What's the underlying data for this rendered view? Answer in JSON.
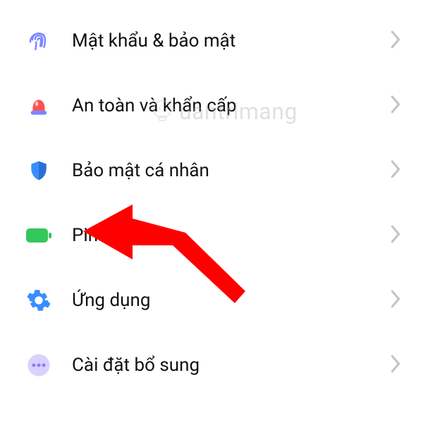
{
  "items": [
    {
      "id": "password-security",
      "label": "Mật khẩu & bảo mật"
    },
    {
      "id": "safety-emergency",
      "label": "An toàn và khẩn cấp"
    },
    {
      "id": "privacy",
      "label": "Bảo mật cá nhân"
    },
    {
      "id": "battery",
      "label": "Pin"
    },
    {
      "id": "apps",
      "label": "Ứng dụng"
    },
    {
      "id": "additional",
      "label": "Cài đặt bổ sung"
    }
  ],
  "watermark": {
    "text": "uantrimang"
  },
  "colors": {
    "fingerprint": "#7a87ff",
    "emergency_body": "#ff5252",
    "emergency_base": "#7a87ff",
    "shield": "#3a8dff",
    "battery": "#34c759",
    "gear": "#3a8dff",
    "dots_bg": "#d9d2ff",
    "dots_fg": "#8a7dff",
    "arrow": "#ff0000",
    "chevron": "#c4c4c4"
  }
}
